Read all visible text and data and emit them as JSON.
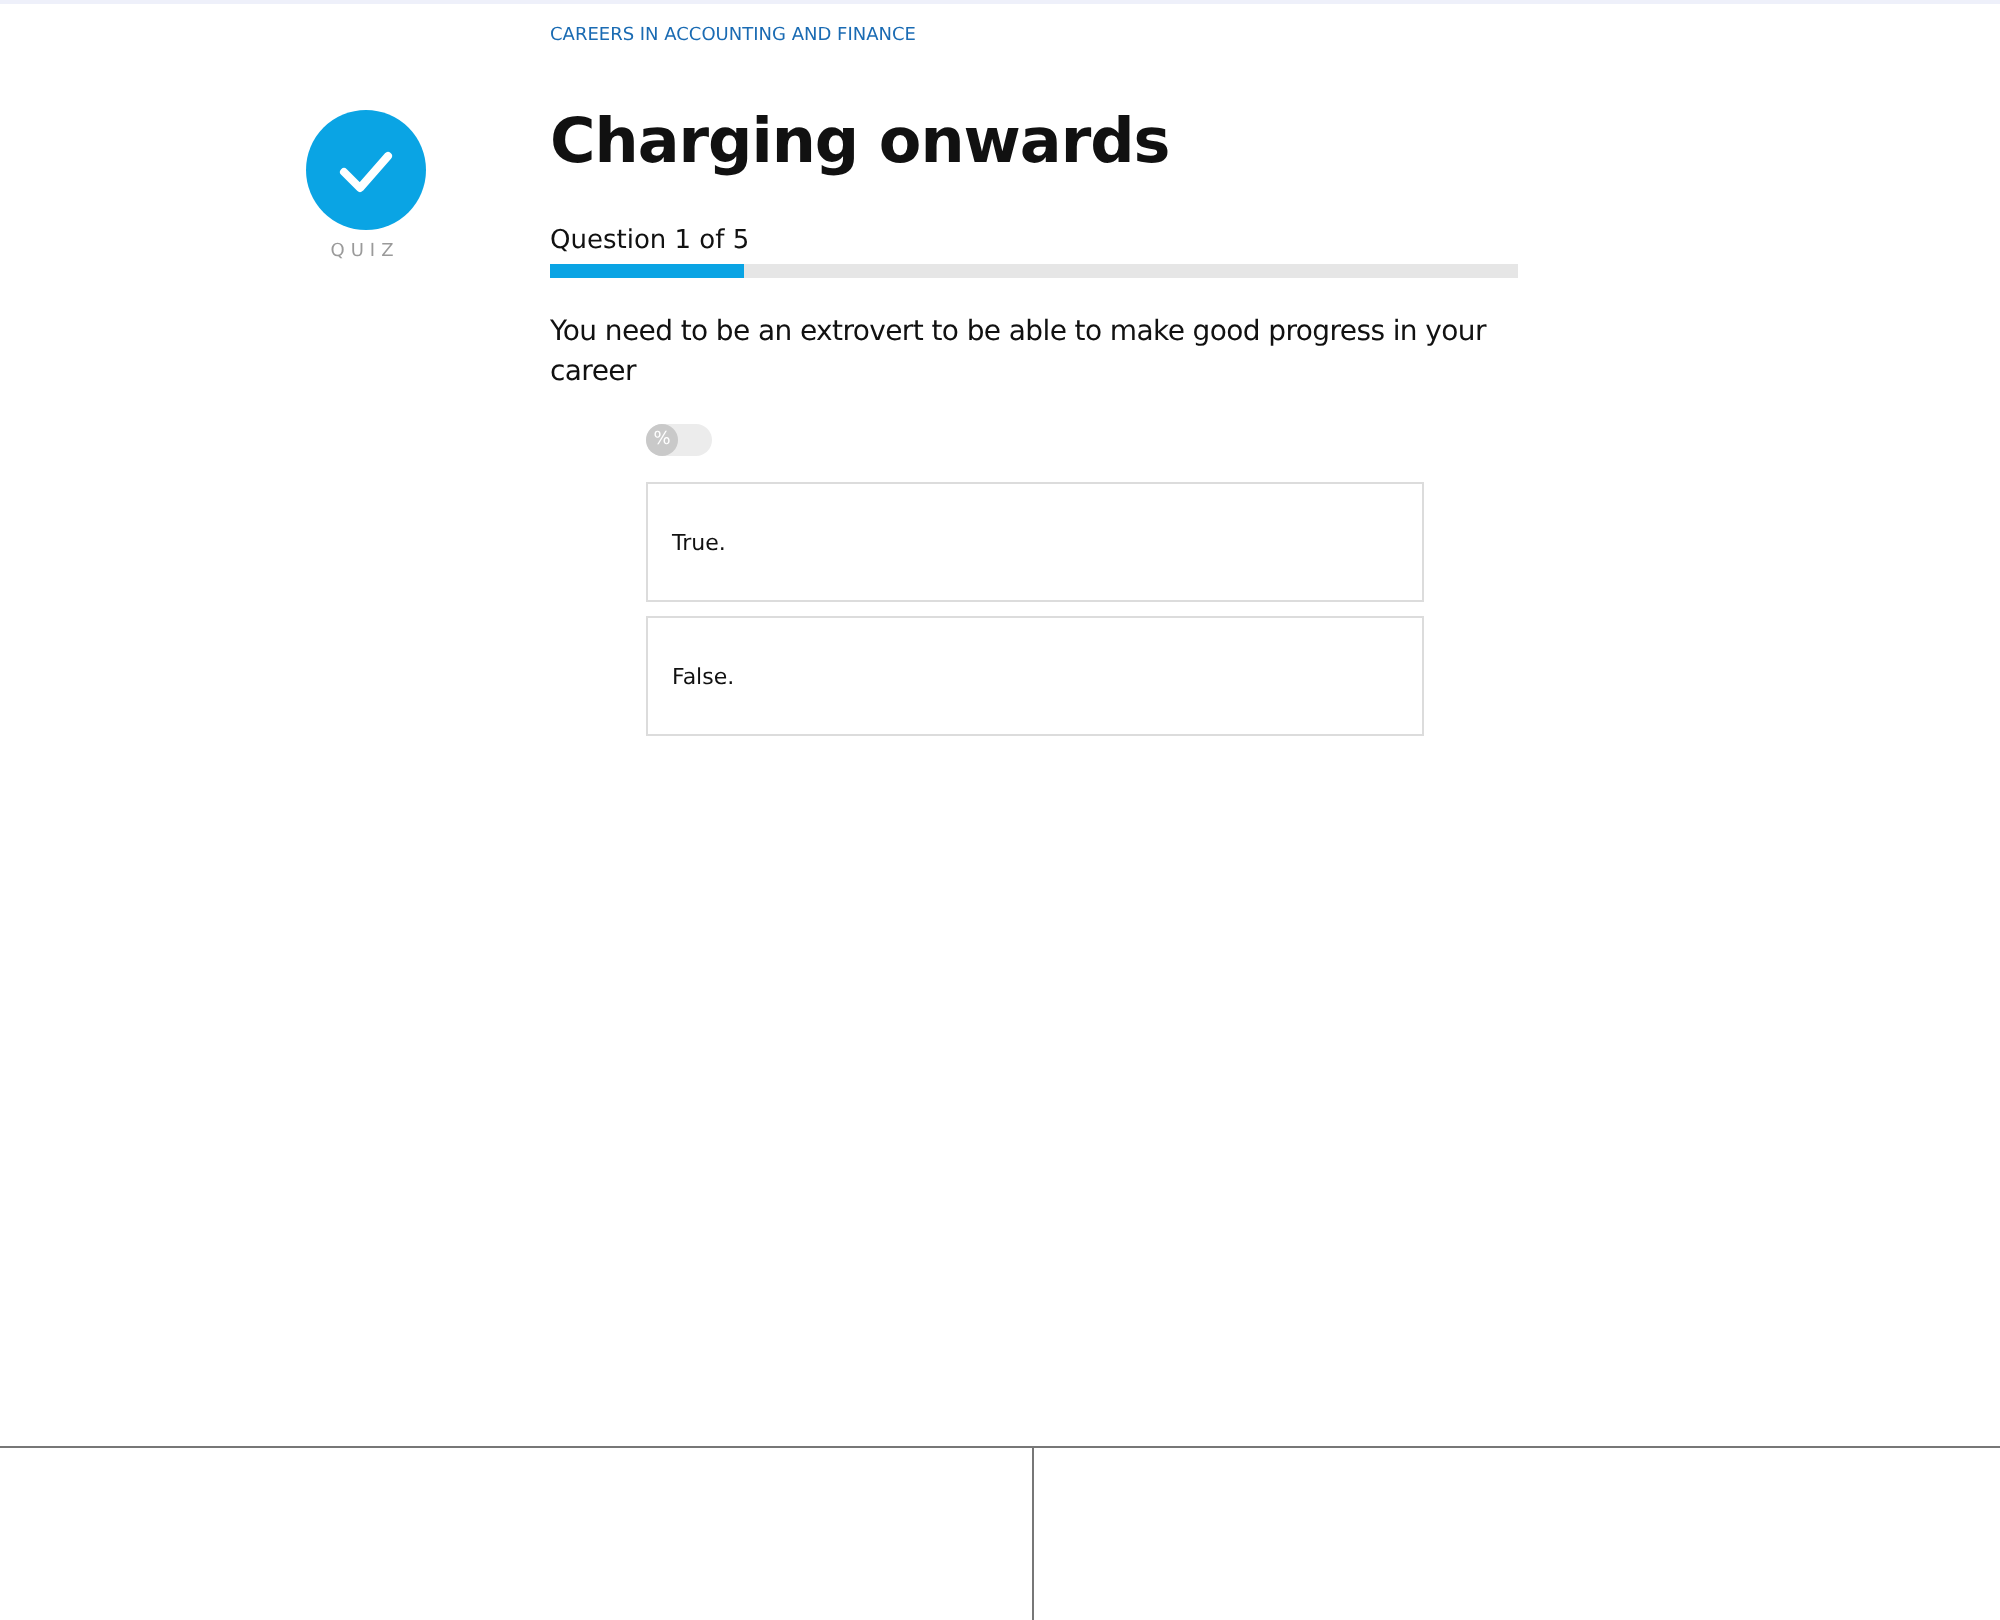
{
  "breadcrumb": "CAREERS IN ACCOUNTING AND FINANCE",
  "badge": {
    "label": "QUIZ"
  },
  "title": "Charging onwards",
  "progress": {
    "label": "Question 1 of 5",
    "level": 0.2
  },
  "question": "You need to be an extrovert to be able to make good progress in your career",
  "toggle": {
    "label": "%",
    "on": false
  },
  "answers": [
    {
      "text": "True.",
      "selected": false
    },
    {
      "text": "False.",
      "selected": false
    }
  ]
}
